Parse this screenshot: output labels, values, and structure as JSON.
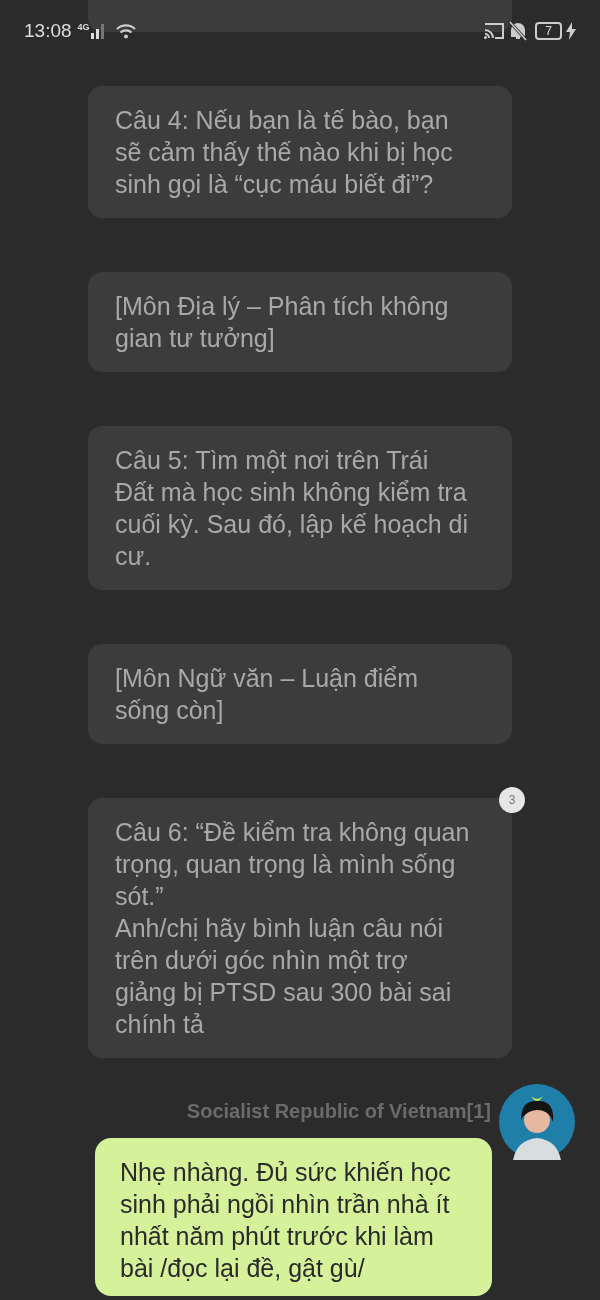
{
  "status_bar": {
    "time": "13:08",
    "network": "4G",
    "battery": "7"
  },
  "messages": [
    {
      "kind": "partial"
    },
    {
      "kind": "received",
      "text": "Câu 4: Nếu bạn là tế bào, bạn sẽ cảm thấy thế nào khi bị học sinh gọi là “cục máu biết đi”?"
    },
    {
      "kind": "received",
      "text": "[Môn Địa lý – Phân tích không gian tư tưởng]"
    },
    {
      "kind": "received",
      "text": "Câu 5: Tìm một nơi trên Trái Đất mà học sinh không kiểm tra cuối kỳ. Sau đó, lập kế hoạch di cư."
    },
    {
      "kind": "received",
      "text": "[Môn Ngữ văn – Luận điểm sống còn]"
    },
    {
      "kind": "received",
      "text": "Câu 6: “Đề kiểm tra không quan trọng, quan trọng là mình sống sót.”\nAnh/chị hãy bình luận câu nói trên dưới góc nhìn một trợ giảng bị PTSD sau 300 bài sai chính tả",
      "badge": "3"
    },
    {
      "kind": "sent",
      "sender": "Socialist Republic of Vietnam[1]",
      "text": "Nhẹ nhàng. Đủ sức khiến học sinh phải ngồi nhìn trần nhà ít nhất năm phút trước khi làm bài /đọc lại đề, gật gù/"
    }
  ]
}
